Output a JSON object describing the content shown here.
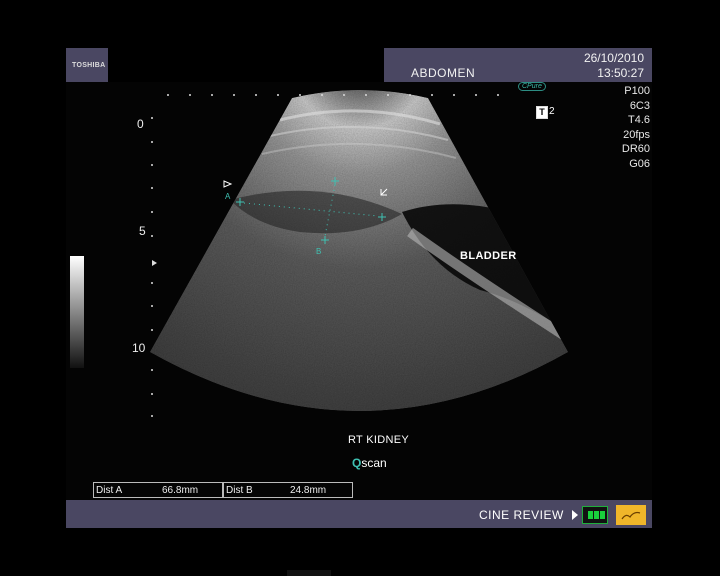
{
  "header": {
    "brand": "TOSHIBA",
    "exam": "ABDOMEN",
    "date": "26/10/2010",
    "time": "13:50:27"
  },
  "params": [
    "P100",
    "6C3",
    "T4.6",
    "20fps",
    "DR60",
    "G06"
  ],
  "badge": {
    "icon_text": "T",
    "value": "2",
    "clear_logo": "CPure"
  },
  "depth_scale": [
    "0",
    "5",
    "10"
  ],
  "image_labels": {
    "bladder": "BLADDER",
    "kidney": "RT KIDNEY",
    "cursor_a": "A",
    "cursor_b": "B"
  },
  "scan_mode": {
    "q": "Q",
    "rest": "scan"
  },
  "measurements": [
    {
      "label": "Dist A",
      "value": "66.8mm"
    },
    {
      "label": "Dist B",
      "value": "24.8mm"
    }
  ],
  "footer": {
    "cine_label": "CINE REVIEW"
  },
  "colors": {
    "header_bar": "#4a4762",
    "cursor": "#3fc2b3",
    "cine_button": "#19d03c",
    "flag": "#f0b62a"
  }
}
